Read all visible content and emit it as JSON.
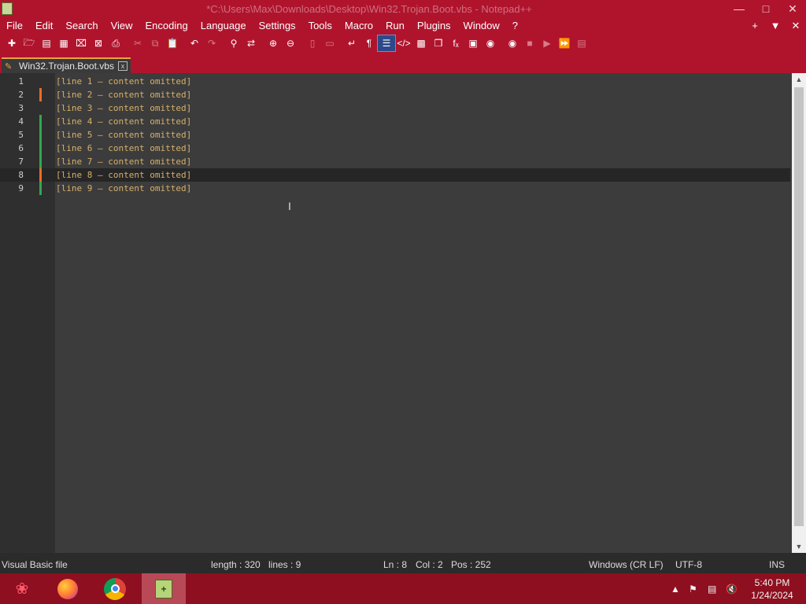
{
  "window": {
    "title": "*C:\\Users\\Max\\Downloads\\Desktop\\Win32.Trojan.Boot.vbs - Notepad++"
  },
  "menu": [
    "File",
    "Edit",
    "Search",
    "View",
    "Encoding",
    "Language",
    "Settings",
    "Tools",
    "Macro",
    "Run",
    "Plugins",
    "Window",
    "?"
  ],
  "window_controls": {
    "minimize": "—",
    "maximize": "□",
    "close": "✕",
    "add": "+",
    "list": "▼",
    "close_doc": "✕"
  },
  "toolbar_icons": [
    "new-file-icon",
    "open-icon",
    "save-icon",
    "save-all-icon",
    "close-icon",
    "close-all-icon",
    "print-icon",
    "cut-icon",
    "copy-icon",
    "paste-icon",
    "undo-icon",
    "redo-icon",
    "find-icon",
    "replace-icon",
    "zoom-in-icon",
    "zoom-out-icon",
    "sync-v-icon",
    "sync-h-icon",
    "word-wrap-icon",
    "show-all-chars-icon",
    "indent-guide-icon",
    "xml-icon",
    "doc-map-icon",
    "doc-list-icon",
    "function-list-icon",
    "folder-workspace-icon",
    "monitoring-icon",
    "record-macro-icon",
    "stop-record-icon",
    "play-macro-icon",
    "run-macro-multiple-icon",
    "save-macro-icon"
  ],
  "tab": {
    "label": "Win32.Trojan.Boot.vbs",
    "close": "x"
  },
  "editor": {
    "lines": [
      {
        "num": "1",
        "text": "[line 1 — content omitted]",
        "marker": ""
      },
      {
        "num": "2",
        "text": "[line 2 — content omitted]",
        "marker": "orange"
      },
      {
        "num": "3",
        "text": "[line 3 — content omitted]",
        "marker": ""
      },
      {
        "num": "4",
        "text": "[line 4 — content omitted]",
        "marker": "green"
      },
      {
        "num": "5",
        "text": "[line 5 — content omitted]",
        "marker": "green"
      },
      {
        "num": "6",
        "text": "[line 6 — content omitted]",
        "marker": "green"
      },
      {
        "num": "7",
        "text": "[line 7 — content omitted]",
        "marker": "green"
      },
      {
        "num": "8",
        "text": "[line 8 — content omitted]",
        "marker": "orange",
        "current": true
      },
      {
        "num": "9",
        "text": "[line 9 — content omitted]",
        "marker": "green"
      }
    ]
  },
  "status": {
    "language": "Visual Basic file",
    "length": "length : 320",
    "lines": "lines : 9",
    "ln": "Ln : 8",
    "col": "Col : 2",
    "pos": "Pos : 252",
    "eol": "Windows (CR LF)",
    "encoding": "UTF-8",
    "mode": "INS"
  },
  "taskbar": {
    "apps": [
      "start-icon",
      "firefox-icon",
      "chrome-icon",
      "notepadpp-icon"
    ],
    "time": "5:40 PM",
    "date": "1/24/2024"
  },
  "colors": {
    "accent": "#b0142d",
    "editor_bg": "#3c3c3c",
    "code_text": "#d6b06b",
    "marker_orange": "#ee6a22",
    "marker_green": "#2fa84f"
  }
}
